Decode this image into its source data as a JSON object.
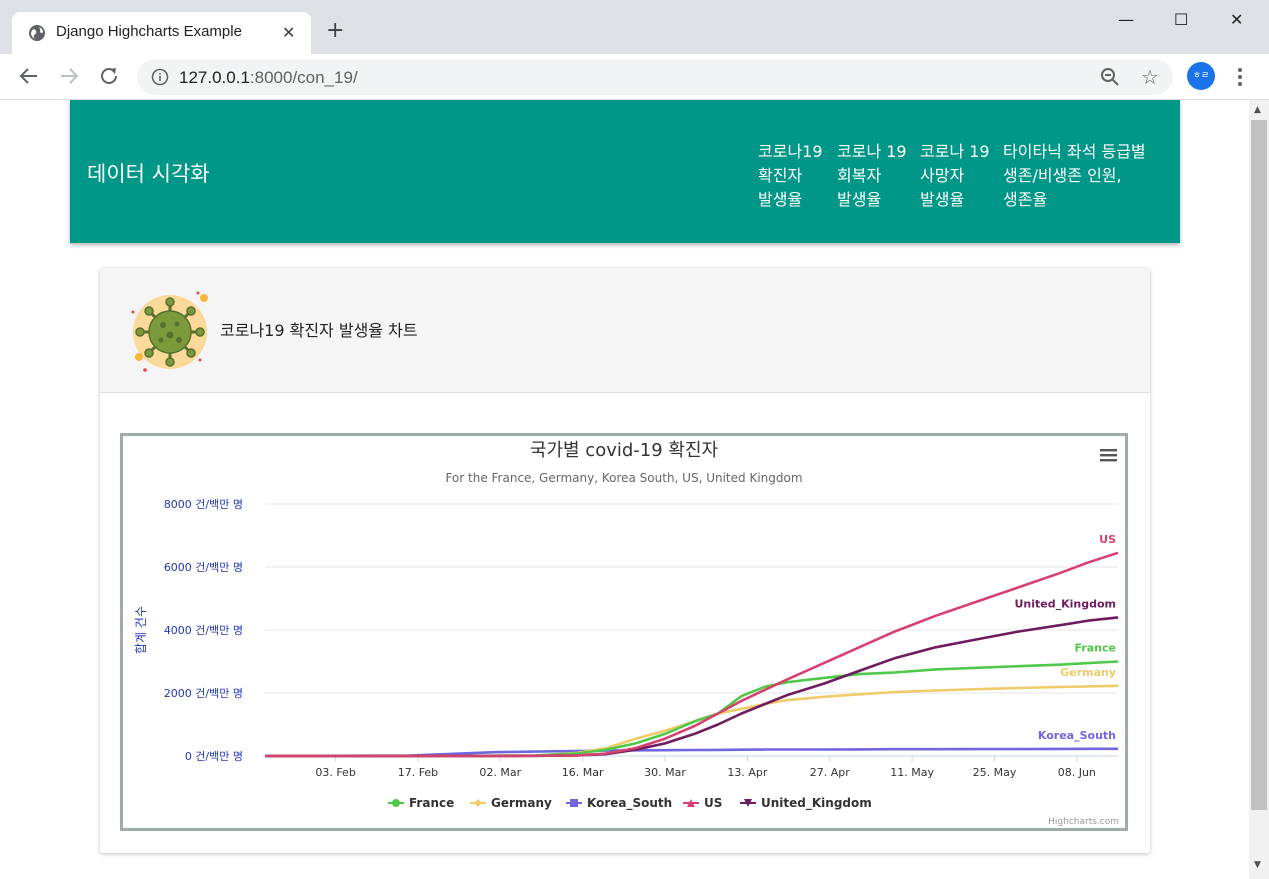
{
  "browser": {
    "tab_title": "Django Highcharts Example",
    "tab_close": "✕",
    "new_tab": "+",
    "url_host": "127.0.0.1",
    "url_rest": ":8000/con_19/",
    "avatar_text": "ㅎㄹ",
    "window": {
      "minimize": "—",
      "maximize": "☐",
      "close": "✕"
    }
  },
  "navbar": {
    "brand": "데이터 시각화",
    "links": [
      {
        "line1": "코로나19",
        "line2": "확진자",
        "line3": "발생율"
      },
      {
        "line1": "코로나 19",
        "line2": "회복자",
        "line3": "발생율"
      },
      {
        "line1": "코로나 19",
        "line2": "사망자",
        "line3": "발생율"
      },
      {
        "line1": "타이타닉 좌석 등급별",
        "line2": "생존/비생존 인원,",
        "line3": "생존율"
      }
    ]
  },
  "card": {
    "title": "코로나19 확진자 발생율 차트"
  },
  "colors": {
    "navbar": "#009688",
    "France": "#4fc94a",
    "Germany": "#f0cb69",
    "Korea_South": "#7066e0",
    "US": "#d6416f",
    "United_Kingdom": "#6e1c5d"
  },
  "chart_data": {
    "type": "line",
    "title": "국가별 covid-19 확진자",
    "subtitle": "For the France, Germany, Korea South, US, United Kingdom",
    "ylabel": "합계 건수",
    "ylim": [
      0,
      8000
    ],
    "yticks": [
      "0 건/백만 명",
      "2000 건/백만 명",
      "4000 건/백만 명",
      "6000 건/백만 명",
      "8000 건/백만 명"
    ],
    "xlim": [
      "2020-01-22",
      "2020-06-15"
    ],
    "xticks": [
      "03. Feb",
      "17. Feb",
      "02. Mar",
      "16. Mar",
      "30. Mar",
      "13. Apr",
      "27. Apr",
      "11. May",
      "25. May",
      "08. Jun"
    ],
    "credits": "Highcharts.com",
    "x": [
      "2020-01-22",
      "2020-02-01",
      "2020-02-15",
      "2020-02-22",
      "2020-03-01",
      "2020-03-08",
      "2020-03-15",
      "2020-03-20",
      "2020-03-25",
      "2020-03-30",
      "2020-04-04",
      "2020-04-08",
      "2020-04-12",
      "2020-04-16",
      "2020-04-20",
      "2020-04-26",
      "2020-05-02",
      "2020-05-08",
      "2020-05-15",
      "2020-05-22",
      "2020-05-29",
      "2020-06-05",
      "2020-06-10",
      "2020-06-15"
    ],
    "series": [
      {
        "name": "France",
        "values": [
          0,
          0,
          0,
          0,
          10,
          20,
          80,
          200,
          400,
          700,
          1100,
          1350,
          1900,
          2200,
          2350,
          2480,
          2600,
          2650,
          2750,
          2800,
          2850,
          2900,
          2950,
          3000
        ]
      },
      {
        "name": "Germany",
        "values": [
          0,
          0,
          0,
          0,
          5,
          15,
          100,
          250,
          550,
          800,
          1100,
          1350,
          1500,
          1650,
          1780,
          1880,
          1960,
          2030,
          2080,
          2120,
          2160,
          2190,
          2210,
          2230
        ]
      },
      {
        "name": "Korea_South",
        "values": [
          0,
          5,
          10,
          60,
          120,
          140,
          160,
          170,
          180,
          185,
          190,
          195,
          200,
          205,
          205,
          205,
          210,
          215,
          215,
          220,
          220,
          225,
          230,
          230
        ]
      },
      {
        "name": "US",
        "values": [
          0,
          0,
          0,
          0,
          0,
          5,
          20,
          80,
          250,
          550,
          950,
          1350,
          1750,
          2100,
          2450,
          2950,
          3450,
          3950,
          4450,
          4900,
          5350,
          5800,
          6150,
          6450
        ]
      },
      {
        "name": "United_Kingdom",
        "values": [
          0,
          0,
          0,
          0,
          0,
          5,
          15,
          60,
          200,
          400,
          700,
          1000,
          1350,
          1650,
          1950,
          2300,
          2700,
          3100,
          3450,
          3700,
          3950,
          4150,
          4300,
          4400
        ]
      }
    ]
  }
}
